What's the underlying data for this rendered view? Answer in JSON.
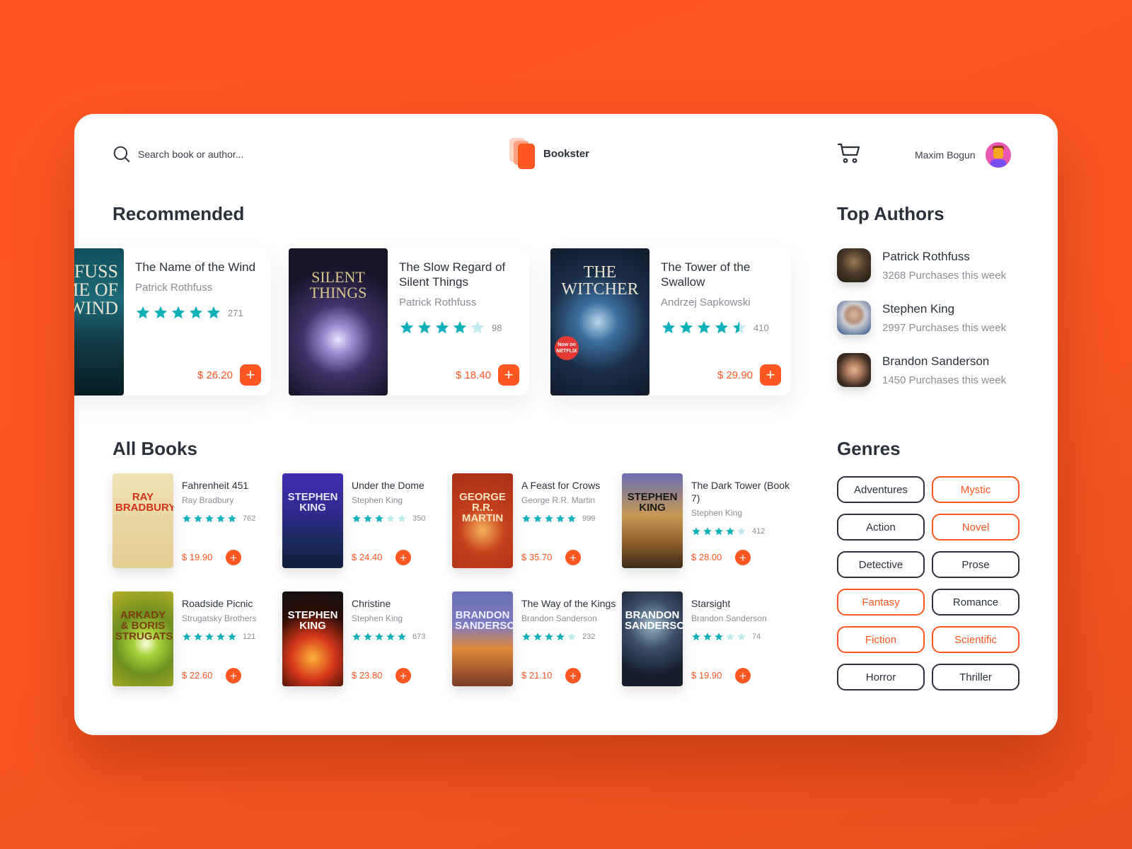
{
  "header": {
    "search_placeholder": "Search book or author...",
    "brand": "Bookster",
    "user_name": "Maxim Bogun"
  },
  "colors": {
    "accent": "#ff5722",
    "star": "#0fb0b8",
    "star_empty": "#bfeaee",
    "text": "#2b313b",
    "muted": "#8a8d93"
  },
  "recommended": {
    "heading": "Recommended",
    "items": [
      {
        "title": "The Name of the Wind",
        "author": "Patrick Rothfuss",
        "rating": 5,
        "count": "271",
        "price": "$ 26.20",
        "cover_text": "RICK FUSS · NAME OF THE WIND"
      },
      {
        "title": "The Slow Regard of Silent Things",
        "author": "Patrick Rothfuss",
        "rating": 4,
        "count": "98",
        "price": "$ 18.40",
        "cover_text": "SILENT THINGS"
      },
      {
        "title": "The Tower of the Swallow",
        "author": "Andrzej Sapkowski",
        "rating": 4.5,
        "count": "410",
        "price": "$ 29.90",
        "cover_text": "THE WITCHER",
        "cover_badge": "Now on NETFLIX"
      }
    ]
  },
  "top_authors": {
    "heading": "Top Authors",
    "items": [
      {
        "name": "Patrick Rothfuss",
        "purchases": "3268 Purchases this week"
      },
      {
        "name": "Stephen King",
        "purchases": "2997 Purchases this week"
      },
      {
        "name": "Brandon Sanderson",
        "purchases": "1450 Purchases this week"
      }
    ]
  },
  "all_books": {
    "heading": "All Books",
    "items": [
      {
        "title": "Fahrenheit 451",
        "author": "Ray Bradbury",
        "rating": 5,
        "count": "762",
        "price": "$ 19.90",
        "cover_text": "RAY BRADBURY"
      },
      {
        "title": "Under the Dome",
        "author": "Stephen King",
        "rating": 3,
        "count": "350",
        "price": "$ 24.40",
        "cover_text": "STEPHEN KING"
      },
      {
        "title": "A Feast for Crows",
        "author": "George R.R. Martin",
        "rating": 5,
        "count": "999",
        "price": "$ 35.70",
        "cover_text": "GEORGE R.R. MARTIN"
      },
      {
        "title": "The Dark Tower (Book 7)",
        "author": "Stephen King",
        "rating": 4,
        "count": "412",
        "price": "$ 28.00",
        "cover_text": "STEPHEN KING"
      },
      {
        "title": "Roadside Picnic",
        "author": "Strugatsky Brothers",
        "rating": 5,
        "count": "121",
        "price": "$ 22.60",
        "cover_text": "ARKADY & BORIS STRUGATSKY"
      },
      {
        "title": "Christine",
        "author": "Stephen King",
        "rating": 5,
        "count": "673",
        "price": "$ 23.80",
        "cover_text": "STEPHEN KING"
      },
      {
        "title": "The Way of the Kings",
        "author": "Brandon Sanderson",
        "rating": 4,
        "count": "232",
        "price": "$ 21.10",
        "cover_text": "BRANDON SANDERSON"
      },
      {
        "title": "Starsight",
        "author": "Brandon Sanderson",
        "rating": 3,
        "count": "74",
        "price": "$ 19.90",
        "cover_text": "BRANDON SANDERSON"
      }
    ]
  },
  "genres": {
    "heading": "Genres",
    "items": [
      {
        "label": "Adventures",
        "active": false
      },
      {
        "label": "Mystic",
        "active": true
      },
      {
        "label": "Action",
        "active": false
      },
      {
        "label": "Novel",
        "active": true
      },
      {
        "label": "Detective",
        "active": false
      },
      {
        "label": "Prose",
        "active": false
      },
      {
        "label": "Fantasy",
        "active": true
      },
      {
        "label": "Romance",
        "active": false
      },
      {
        "label": "Fiction",
        "active": true
      },
      {
        "label": "Scientific",
        "active": true
      },
      {
        "label": "Horror",
        "active": false
      },
      {
        "label": "Thriller",
        "active": false
      }
    ]
  }
}
